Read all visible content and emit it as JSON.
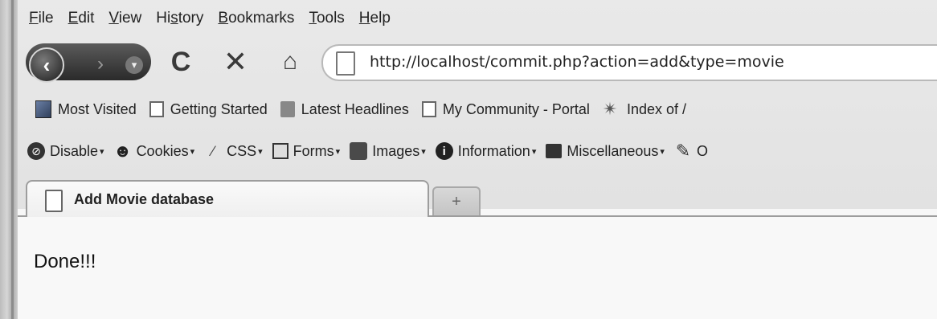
{
  "menu": [
    {
      "pre": "",
      "u": "F",
      "post": "ile"
    },
    {
      "pre": "",
      "u": "E",
      "post": "dit"
    },
    {
      "pre": "",
      "u": "V",
      "post": "iew"
    },
    {
      "pre": "Hi",
      "u": "s",
      "post": "tory"
    },
    {
      "pre": "",
      "u": "B",
      "post": "ookmarks"
    },
    {
      "pre": "",
      "u": "T",
      "post": "ools"
    },
    {
      "pre": "",
      "u": "H",
      "post": "elp"
    }
  ],
  "navbar": {
    "url": "http://localhost/commit.php?action=add&type=movie",
    "icons": {
      "back": "back-arrow-icon",
      "forward": "forward-arrow-icon",
      "history": "history-dropdown-icon",
      "reload": "reload-icon",
      "stop": "stop-icon",
      "home": "home-icon",
      "page": "page-icon"
    }
  },
  "bookmarks": [
    {
      "label": "Most Visited",
      "icon": "most-visited-icon"
    },
    {
      "label": "Getting Started",
      "icon": "page-icon"
    },
    {
      "label": "Latest Headlines",
      "icon": "rss-icon"
    },
    {
      "label": "My Community - Portal",
      "icon": "page-icon"
    },
    {
      "label": "Index of /",
      "icon": "satellite-icon"
    }
  ],
  "devtoolbar": [
    {
      "label": "Disable",
      "icon": "disable-icon"
    },
    {
      "label": "Cookies",
      "icon": "cookies-icon"
    },
    {
      "label": "CSS",
      "icon": "css-icon"
    },
    {
      "label": "Forms",
      "icon": "forms-icon"
    },
    {
      "label": "Images",
      "icon": "images-icon"
    },
    {
      "label": "Information",
      "icon": "information-icon"
    },
    {
      "label": "Miscellaneous",
      "icon": "miscellaneous-icon"
    },
    {
      "label": "O",
      "icon": "outline-icon"
    }
  ],
  "tab": {
    "title": "Add Movie database",
    "newtab": "+"
  },
  "content": {
    "text": "Done!!!"
  }
}
